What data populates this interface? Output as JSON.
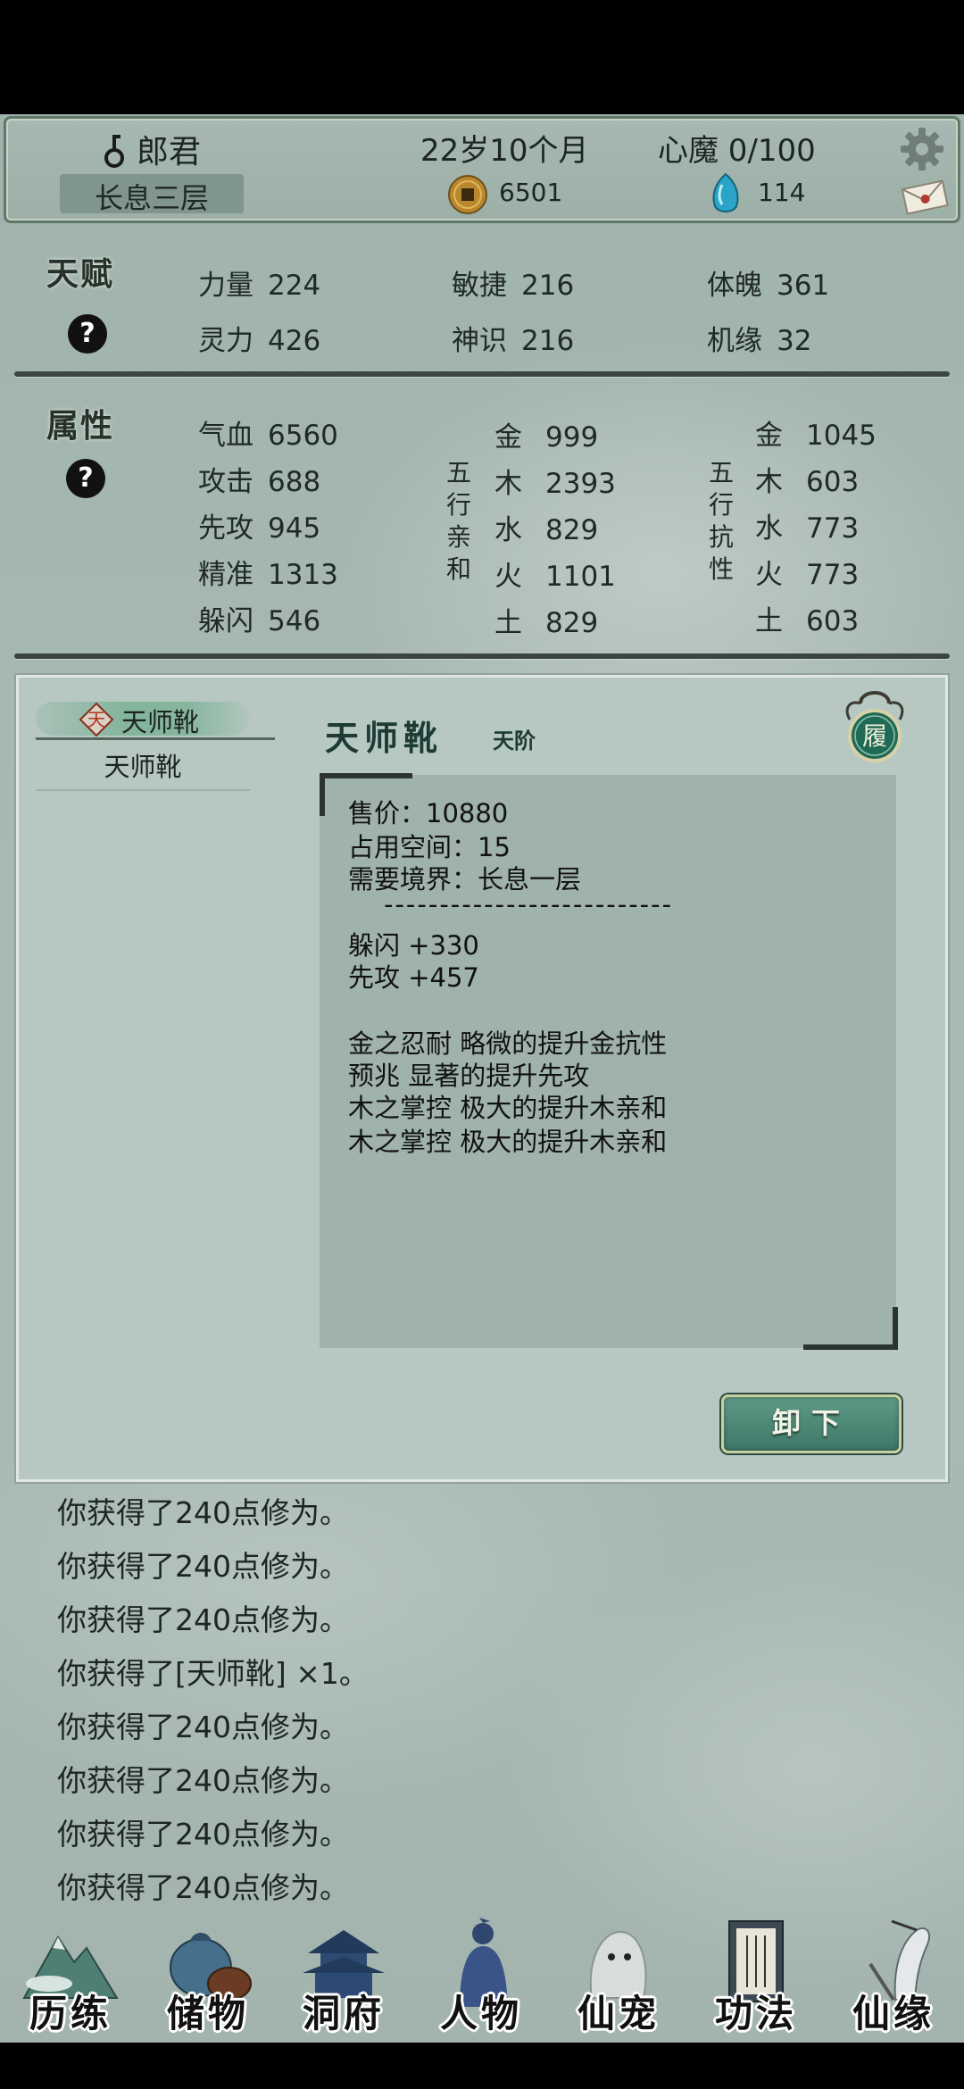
{
  "header": {
    "player_name": "郎君",
    "realm": "长息三层",
    "age": "22岁10个月",
    "xinmo": "心魔 0/100",
    "coins": "6501",
    "gems": "114"
  },
  "talent": {
    "title": "天赋",
    "help": "?",
    "stats": [
      {
        "label": "力量",
        "value": "224"
      },
      {
        "label": "敏捷",
        "value": "216"
      },
      {
        "label": "体魄",
        "value": "361"
      },
      {
        "label": "灵力",
        "value": "426"
      },
      {
        "label": "神识",
        "value": "216"
      },
      {
        "label": "机缘",
        "value": "32"
      }
    ]
  },
  "attributes": {
    "title": "属性",
    "help": "?",
    "basic": [
      {
        "label": "气血",
        "value": "6560"
      },
      {
        "label": "攻击",
        "value": "688"
      },
      {
        "label": "先攻",
        "value": "945"
      },
      {
        "label": "精准",
        "value": "1313"
      },
      {
        "label": "躲闪",
        "value": "546"
      }
    ],
    "affinity_label": [
      "五",
      "行",
      "亲",
      "和"
    ],
    "affinity": [
      {
        "label": "金",
        "value": "999"
      },
      {
        "label": "木",
        "value": "2393"
      },
      {
        "label": "水",
        "value": "829"
      },
      {
        "label": "火",
        "value": "1101"
      },
      {
        "label": "土",
        "value": "829"
      }
    ],
    "resist_label": [
      "五",
      "行",
      "抗",
      "性"
    ],
    "resist": [
      {
        "label": "金",
        "value": "1045"
      },
      {
        "label": "木",
        "value": "603"
      },
      {
        "label": "水",
        "value": "773"
      },
      {
        "label": "火",
        "value": "773"
      },
      {
        "label": "土",
        "value": "603"
      }
    ]
  },
  "item_panel": {
    "tab_label": "天师靴",
    "tab_icon_char": "天",
    "list": [
      "天师靴"
    ],
    "item_name": "天师靴",
    "item_tier": "天阶",
    "slot_char": "履",
    "desc_lines": [
      "售价：10880",
      "占用空间：15",
      "需要境界：长息一层",
      "--------------------------",
      "躲闪 +330",
      "先攻 +457",
      "",
      "金之忍耐 略微的提升金抗性",
      "预兆 显著的提升先攻",
      "木之掌控 极大的提升木亲和",
      "木之掌控 极大的提升木亲和"
    ],
    "unequip_label": "卸下"
  },
  "log": [
    "你获得了240点修为。",
    "你获得了240点修为。",
    "你获得了240点修为。",
    "你获得了[天师靴] ×1。",
    "你获得了240点修为。",
    "你获得了240点修为。",
    "你获得了240点修为。",
    "你获得了240点修为。"
  ],
  "nav": [
    {
      "label": "历练",
      "icon": "mountain-icon"
    },
    {
      "label": "储物",
      "icon": "pouch-icon"
    },
    {
      "label": "洞府",
      "icon": "pavilion-icon"
    },
    {
      "label": "人物",
      "icon": "character-icon"
    },
    {
      "label": "仙宠",
      "icon": "pet-icon"
    },
    {
      "label": "功法",
      "icon": "book-icon"
    },
    {
      "label": "仙缘",
      "icon": "crane-icon"
    }
  ],
  "colors": {
    "accent": "#3d7767",
    "panel": "#b7c8c2",
    "desc_bg": "#9fb2ab",
    "coin": "#b8872e",
    "gem": "#2aa4c8"
  }
}
